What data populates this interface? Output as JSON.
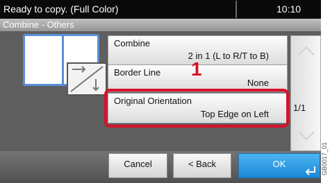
{
  "status": {
    "message": "Ready to copy. (Full Color)",
    "time": "10:10"
  },
  "breadcrumb": "Combine - Others",
  "options": [
    {
      "label": "Combine",
      "value": "2 in 1 (L to R/T to B)"
    },
    {
      "label": "Border Line",
      "value": "None"
    },
    {
      "label": "Original Orientation",
      "value": "Top Edge on Left"
    }
  ],
  "callout_number": "1",
  "pagination": "1/1",
  "buttons": {
    "cancel": "Cancel",
    "back": "< Back",
    "ok": "OK"
  },
  "icons": {
    "scroll_up": "chevron-up-icon",
    "scroll_down": "chevron-down-icon",
    "ok_enter": "enter-icon",
    "preview": "combine-2in1-preview-icon",
    "orientation": "original-orientation-icon"
  },
  "colors": {
    "highlight": "#d8102a",
    "ok_button": "#1c88d8",
    "preview_border": "#5a8fd4"
  },
  "image_code": "GB0017_01"
}
